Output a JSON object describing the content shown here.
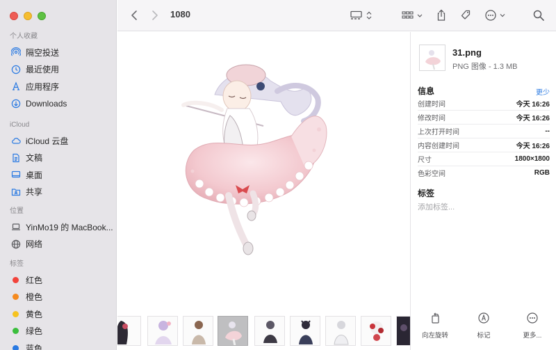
{
  "window": {
    "folder_title": "1080"
  },
  "sidebar": {
    "favorites_header": "个人收藏",
    "favorites": [
      {
        "label": "隔空投送",
        "icon": "airdrop-icon"
      },
      {
        "label": "最近使用",
        "icon": "clock-icon"
      },
      {
        "label": "应用程序",
        "icon": "applications-icon"
      },
      {
        "label": "Downloads",
        "icon": "downloads-icon"
      }
    ],
    "icloud_header": "iCloud",
    "icloud": [
      {
        "label": "iCloud 云盘",
        "icon": "cloud-icon"
      },
      {
        "label": "文稿",
        "icon": "document-icon"
      },
      {
        "label": "桌面",
        "icon": "desktop-icon"
      },
      {
        "label": "共享",
        "icon": "shared-folder-icon"
      }
    ],
    "locations_header": "位置",
    "locations": [
      {
        "label": "YinMo19 的 MacBook...",
        "icon": "laptop-icon"
      },
      {
        "label": "网络",
        "icon": "network-icon"
      }
    ],
    "tags_header": "标签",
    "tags": [
      {
        "label": "红色",
        "color": "#f2433b"
      },
      {
        "label": "橙色",
        "color": "#f58a1f"
      },
      {
        "label": "黄色",
        "color": "#f6c31f"
      },
      {
        "label": "绿色",
        "color": "#3bbe3d"
      },
      {
        "label": "蓝色",
        "color": "#2a7ae2"
      }
    ]
  },
  "inspector": {
    "file_name": "31.png",
    "file_kind": "PNG 图像 - 1.3 MB",
    "info_header": "信息",
    "less_link": "更少",
    "rows": [
      {
        "key": "创建时间",
        "value": "今天 16:26"
      },
      {
        "key": "修改时间",
        "value": "今天 16:26"
      },
      {
        "key": "上次打开时间",
        "value": "--"
      },
      {
        "key": "内容创建时间",
        "value": "今天 16:26"
      },
      {
        "key": "尺寸",
        "value": "1800×1800"
      },
      {
        "key": "色彩空间",
        "value": "RGB"
      }
    ],
    "tags_header": "标签",
    "tags_placeholder": "添加标签...",
    "actions": [
      {
        "label": "向左旋转",
        "icon": "rotate-left-icon"
      },
      {
        "label": "标记",
        "icon": "markup-icon"
      },
      {
        "label": "更多...",
        "icon": "more-icon"
      }
    ]
  },
  "filmstrip": {
    "selected_index": 3,
    "count": 9
  },
  "colors": {
    "accent": "#2a7ae2",
    "sidebar_bg": "#e6e4e8",
    "toolbar_bg": "#f6f5f7"
  }
}
